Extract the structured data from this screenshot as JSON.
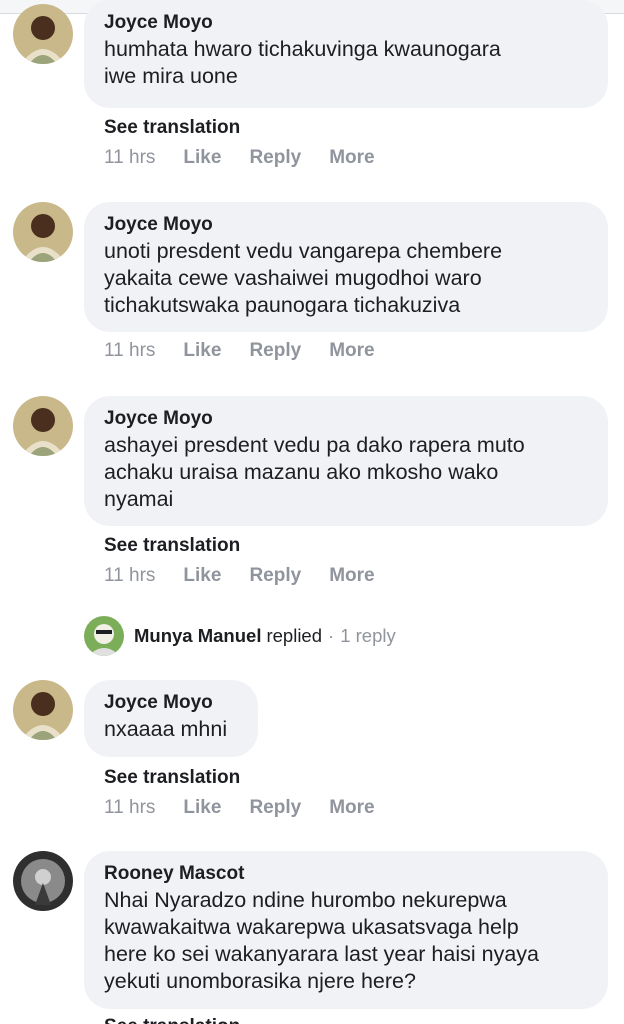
{
  "comments": [
    {
      "author": "Joyce Moyo",
      "lines": [
        "humhata hwaro tichakuvinga kwaunogara",
        "iwe mira uone"
      ],
      "see_translation": "See translation"
    },
    {
      "author": "Joyce Moyo",
      "lines": [
        "unoti presdent vedu vangarepa chembere",
        "yakaita cewe vashaiwei mugodhoi waro",
        "tichakutswaka paunogara tichakuziva"
      ]
    },
    {
      "author": "Joyce Moyo",
      "lines": [
        "ashayei presdent vedu pa dako rapera muto",
        "achaku uraisa mazanu ako mkosho wako",
        "nyamai"
      ],
      "see_translation": "See translation"
    },
    {
      "author": "Joyce Moyo",
      "lines": [
        "nxaaaa mhni"
      ],
      "see_translation": "See translation"
    },
    {
      "author": "Rooney Mascot",
      "lines": [
        "Nhai Nyaradzo ndine hurombo nekurepwa",
        "kwawakaitwa wakarepwa ukasatsvaga help",
        "here ko sei wakanyarara last year haisi nyaya",
        "yekuti unomborasika njere here?"
      ],
      "see_translation": "See translation"
    }
  ],
  "meta": {
    "time": "11 hrs",
    "like": "Like",
    "reply": "Reply",
    "more": "More"
  },
  "reply_row": {
    "name": "Munya Manuel",
    "replied": "replied",
    "separator": "·",
    "count": "1 reply"
  }
}
